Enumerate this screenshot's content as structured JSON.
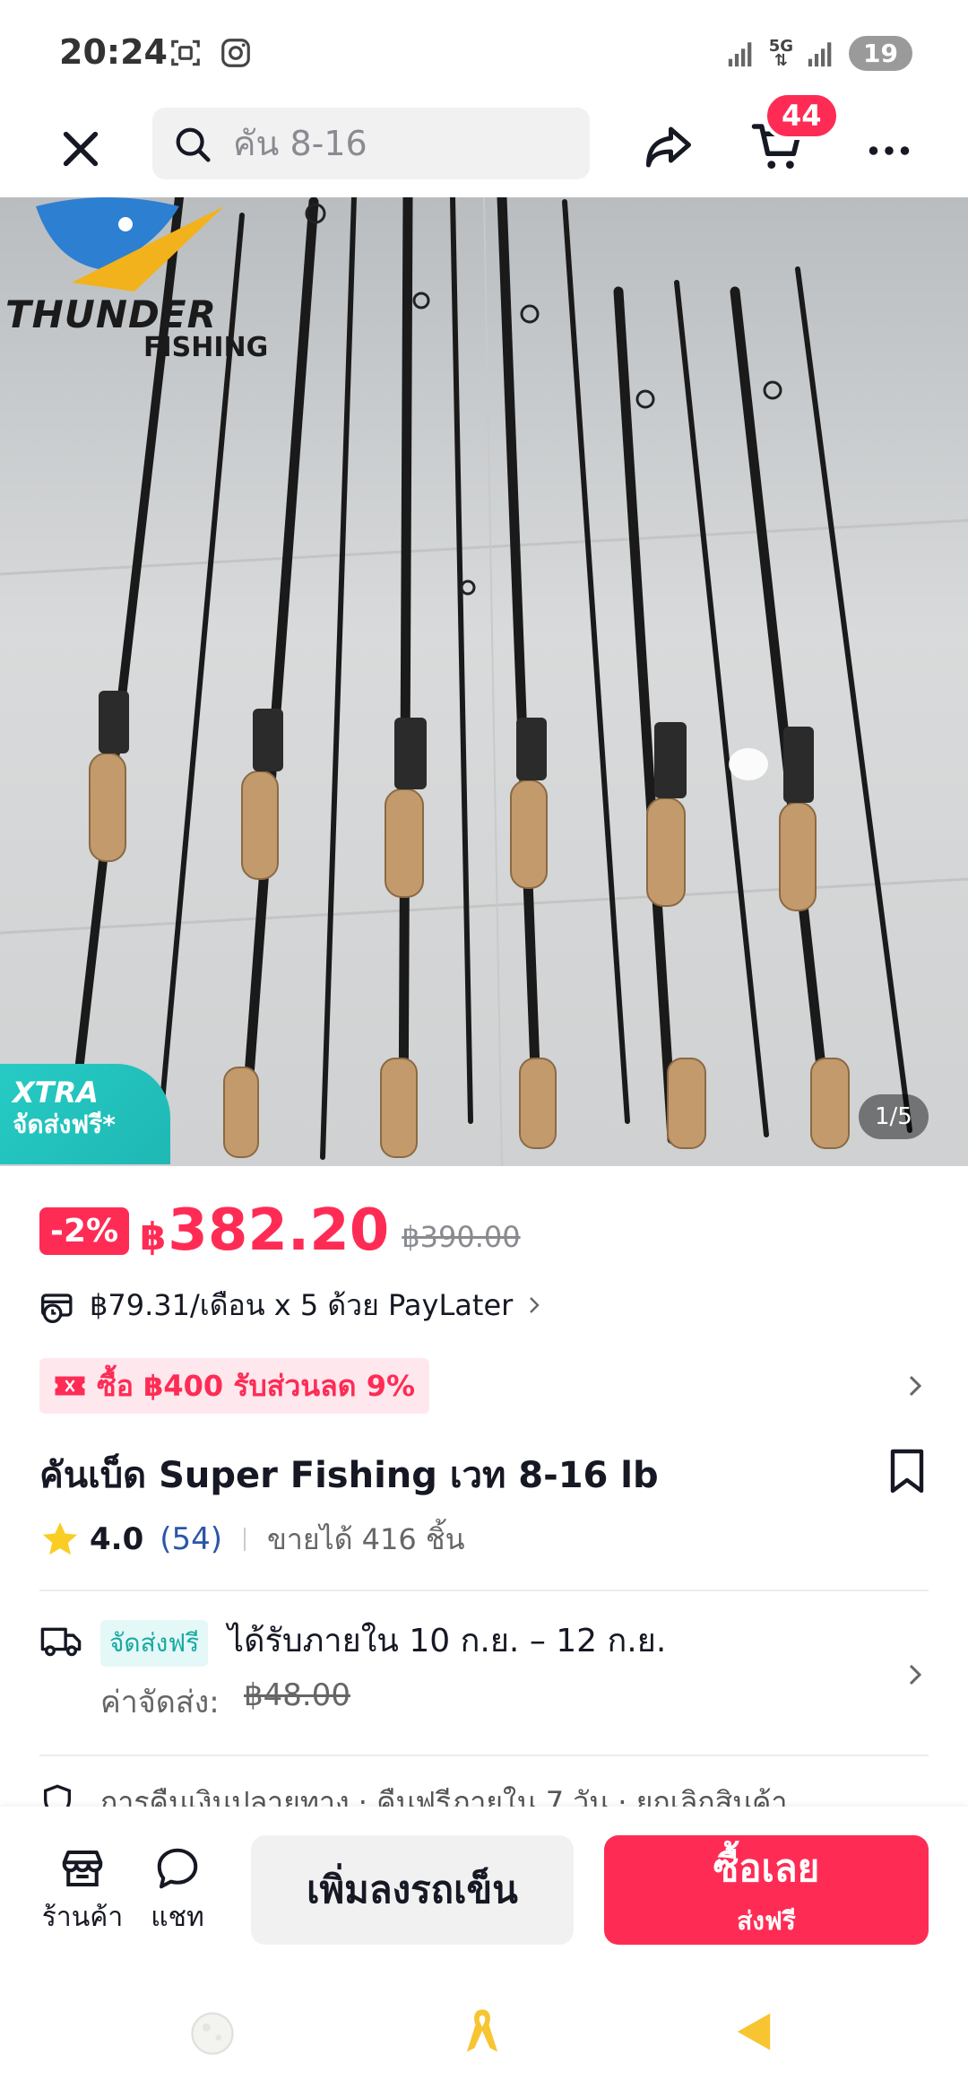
{
  "status_bar": {
    "time": "20:24",
    "network": "5G",
    "battery": "19"
  },
  "top_nav": {
    "search_placeholder": "คัน 8-16",
    "cart_badge": "44"
  },
  "hero": {
    "brand_line1": "THUNDER",
    "brand_line2": "FISHING",
    "xtra_line1": "XTRA",
    "xtra_line2": "จัดส่งฟรี*",
    "image_counter": "1/5"
  },
  "price": {
    "discount": "-2%",
    "currency": "฿",
    "current": "382.20",
    "original": "฿390.00"
  },
  "paylater": {
    "text": "฿79.31/เดือน x 5 ด้วย PayLater"
  },
  "promo": {
    "text": "ซื้อ ฿400 รับส่วนลด 9%"
  },
  "product": {
    "title": "คันเบ็ด Super Fishing เวท 8-16 lb",
    "rating": "4.0",
    "rating_count": "(54)",
    "sold": "ขายได้ 416 ชิ้น"
  },
  "shipping": {
    "free_label": "จัดส่งฟรี",
    "delivery": "ได้รับภายใน 10 ก.ย. – 12 ก.ย.",
    "fee_label": "ค่าจัดส่ง:",
    "fee_value": "฿48.00"
  },
  "guarantee": {
    "text": "การคืนเงินปลายทาง · คืนฟรีภายใน 7 วัน · ยกเลิกสินค้า"
  },
  "action_bar": {
    "store_label": "ร้านค้า",
    "chat_label": "แชท",
    "add_to_cart": "เพิ่มลงรถเข็น",
    "buy_now": "ซื้อเลย",
    "buy_sub": "ส่งฟรี"
  },
  "colors": {
    "accent": "#fe2c55",
    "teal": "#26cbc4"
  }
}
